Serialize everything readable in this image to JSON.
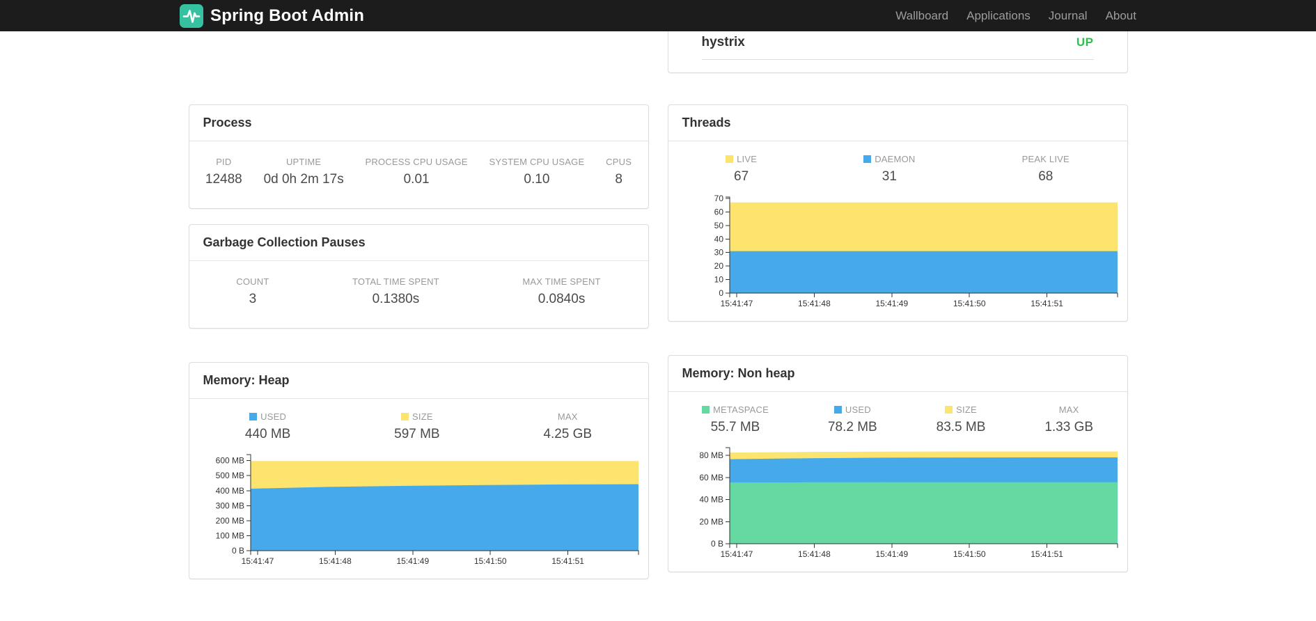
{
  "navbar": {
    "brand": "Spring Boot Admin",
    "links": [
      "Wallboard",
      "Applications",
      "Journal",
      "About"
    ]
  },
  "application": {
    "name": "hystrix",
    "status": "UP"
  },
  "colors": {
    "navbar_bg": "#1c1c1c",
    "brand_logo_green": "#35C2A1",
    "status_up": "#2EBD4E",
    "area_yellow": "#FCE46F",
    "area_blue": "#45A9EA",
    "area_green": "#66D9A2"
  },
  "panels": {
    "process": {
      "title": "Process",
      "stats": [
        {
          "label": "PID",
          "value": "12488"
        },
        {
          "label": "UPTIME",
          "value": "0d 0h 2m 17s"
        },
        {
          "label": "PROCESS CPU USAGE",
          "value": "0.01"
        },
        {
          "label": "SYSTEM CPU USAGE",
          "value": "0.10"
        },
        {
          "label": "CPUS",
          "value": "8"
        }
      ]
    },
    "gc": {
      "title": "Garbage Collection Pauses",
      "stats": [
        {
          "label": "COUNT",
          "value": "3"
        },
        {
          "label": "TOTAL TIME SPENT",
          "value": "0.1380s"
        },
        {
          "label": "MAX TIME SPENT",
          "value": "0.0840s"
        }
      ]
    },
    "threads": {
      "title": "Threads",
      "stats": [
        {
          "label": "LIVE",
          "value": "67",
          "swatch": "#FCE46F"
        },
        {
          "label": "DAEMON",
          "value": "31",
          "swatch": "#45A9EA"
        },
        {
          "label": "PEAK LIVE",
          "value": "68"
        }
      ]
    },
    "heap": {
      "title": "Memory: Heap",
      "stats": [
        {
          "label": "USED",
          "value": "440 MB",
          "swatch": "#45A9EA"
        },
        {
          "label": "SIZE",
          "value": "597 MB",
          "swatch": "#FCE46F"
        },
        {
          "label": "MAX",
          "value": "4.25 GB"
        }
      ]
    },
    "nonheap": {
      "title": "Memory: Non heap",
      "stats": [
        {
          "label": "METASPACE",
          "value": "55.7 MB",
          "swatch": "#66D9A2"
        },
        {
          "label": "USED",
          "value": "78.2 MB",
          "swatch": "#45A9EA"
        },
        {
          "label": "SIZE",
          "value": "83.5 MB",
          "swatch": "#FCE46F"
        },
        {
          "label": "MAX",
          "value": "1.33 GB"
        }
      ]
    }
  },
  "chart_data": [
    {
      "id": "threads",
      "type": "area",
      "title": "Threads",
      "x_labels": [
        "15:41:47",
        "15:41:48",
        "15:41:49",
        "15:41:50",
        "15:41:51"
      ],
      "ylim": [
        0,
        71
      ],
      "y_ticks": [
        {
          "v": 0,
          "label": "0"
        },
        {
          "v": 10,
          "label": "10"
        },
        {
          "v": 20,
          "label": "20"
        },
        {
          "v": 30,
          "label": "30"
        },
        {
          "v": 40,
          "label": "40"
        },
        {
          "v": 50,
          "label": "50"
        },
        {
          "v": 60,
          "label": "60"
        },
        {
          "v": 70,
          "label": "70"
        }
      ],
      "series": [
        {
          "name": "LIVE",
          "color": "#FCE46F",
          "values": [
            67,
            67,
            67,
            67,
            67,
            67
          ]
        },
        {
          "name": "DAEMON",
          "color": "#45A9EA",
          "values": [
            31,
            31,
            31,
            31,
            31,
            31
          ]
        }
      ]
    },
    {
      "id": "heap",
      "type": "area",
      "title": "Memory: Heap",
      "x_labels": [
        "15:41:47",
        "15:41:48",
        "15:41:49",
        "15:41:50",
        "15:41:51"
      ],
      "ylim": [
        0,
        640
      ],
      "y_ticks": [
        {
          "v": 0,
          "label": "0 B"
        },
        {
          "v": 100,
          "label": "100 MB"
        },
        {
          "v": 200,
          "label": "200 MB"
        },
        {
          "v": 300,
          "label": "300 MB"
        },
        {
          "v": 400,
          "label": "400 MB"
        },
        {
          "v": 500,
          "label": "500 MB"
        },
        {
          "v": 600,
          "label": "600 MB"
        }
      ],
      "series": [
        {
          "name": "SIZE",
          "color": "#FCE46F",
          "values": [
            597,
            597,
            597,
            597,
            597,
            597
          ]
        },
        {
          "name": "USED",
          "color": "#45A9EA",
          "values": [
            413,
            425,
            432,
            437,
            441,
            443
          ]
        }
      ]
    },
    {
      "id": "nonheap",
      "type": "area",
      "title": "Memory: Non heap",
      "x_labels": [
        "15:41:47",
        "15:41:48",
        "15:41:49",
        "15:41:50",
        "15:41:51"
      ],
      "ylim": [
        0,
        87
      ],
      "y_ticks": [
        {
          "v": 0,
          "label": "0 B"
        },
        {
          "v": 20,
          "label": "20 MB"
        },
        {
          "v": 40,
          "label": "40 MB"
        },
        {
          "v": 60,
          "label": "60 MB"
        },
        {
          "v": 80,
          "label": "80 MB"
        }
      ],
      "series": [
        {
          "name": "SIZE",
          "color": "#FCE46F",
          "values": [
            82.5,
            83.1,
            83.4,
            83.5,
            83.5,
            83.5
          ]
        },
        {
          "name": "USED",
          "color": "#45A9EA",
          "values": [
            76.5,
            77.4,
            77.9,
            78.1,
            78.2,
            78.2
          ]
        },
        {
          "name": "METASPACE",
          "color": "#66D9A2",
          "values": [
            55.5,
            55.6,
            55.7,
            55.7,
            55.7,
            55.7
          ]
        }
      ]
    }
  ]
}
